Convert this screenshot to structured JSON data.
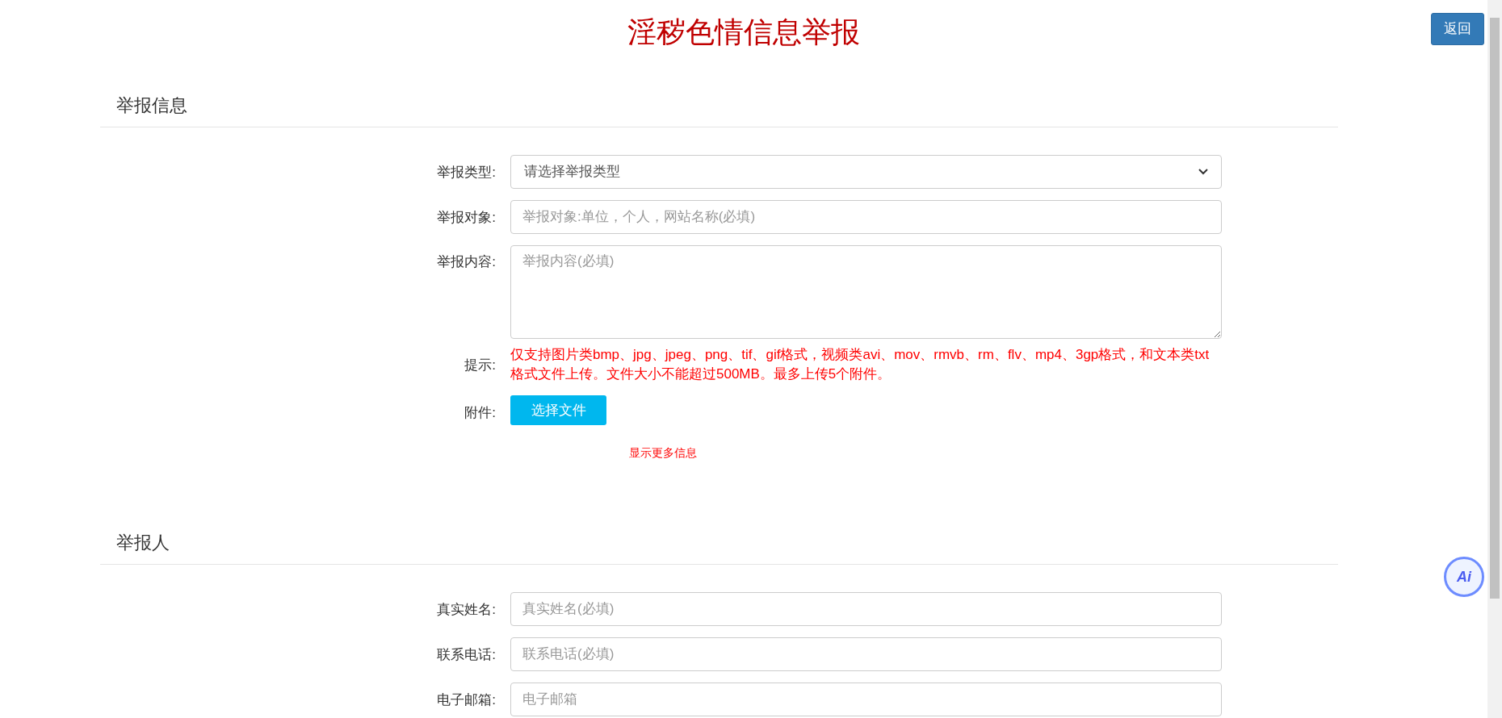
{
  "title": "淫秽色情信息举报",
  "back_button": "返回",
  "sections": [
    {
      "heading": "举报信息",
      "fields": [
        {
          "kind": "select",
          "label": "举报类型:",
          "value": "请选择举报类型"
        },
        {
          "kind": "input",
          "label": "举报对象:",
          "placeholder": "举报对象:单位，个人，网站名称(必填)"
        },
        {
          "kind": "textarea",
          "label": "举报内容:",
          "placeholder": "举报内容(必填)"
        },
        {
          "kind": "hint",
          "label": "提示:",
          "text": "仅支持图片类bmp、jpg、jpeg、png、tif、gif格式，视频类avi、mov、rmvb、rm、flv、mp4、3gp格式，和文本类txt格式文件上传。文件大小不能超过500MB。最多上传5个附件。"
        },
        {
          "kind": "file",
          "label": "附件:",
          "button": "选择文件"
        }
      ],
      "more_link": "显示更多信息"
    },
    {
      "heading": "举报人",
      "fields": [
        {
          "kind": "input",
          "label": "真实姓名:",
          "placeholder": "真实姓名(必填)"
        },
        {
          "kind": "input",
          "label": "联系电话:",
          "placeholder": "联系电话(必填)"
        },
        {
          "kind": "input",
          "label": "电子邮箱:",
          "placeholder": "电子邮箱"
        }
      ]
    }
  ],
  "ai_button": "Ai"
}
